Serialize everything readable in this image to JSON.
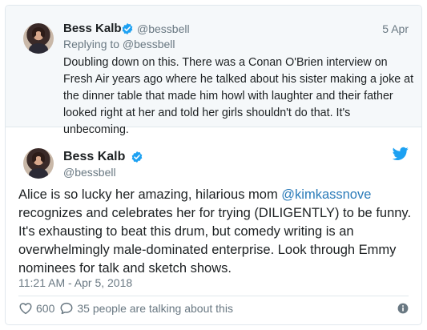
{
  "parent_tweet": {
    "name": "Bess Kalb",
    "handle": "@bessbell",
    "date": "5 Apr",
    "replying_to": "Replying to @bessbell",
    "text": "Doubling down on this. There was a Conan O'Brien interview on Fresh Air years ago where he talked about his sister making a joke at the dinner table that made him howl with laughter and their father looked right at her and told her girls shouldn't do that. It's unbecoming."
  },
  "tweet": {
    "name": "Bess Kalb",
    "handle": "@bessbell",
    "text_before": "Alice is so lucky her amazing, hilarious mom ",
    "mention": "@kimkassnove",
    "text_after": " recognizes and celebrates her for trying (DILIGENTLY) to be funny. It's exhausting to beat this drum, but comedy writing is an overwhelmingly male-dominated enterprise. Look through Emmy nominees for talk and sketch shows.",
    "timestamp": "11:21 AM - Apr 5, 2018",
    "likes": "600",
    "conversation": "35 people are talking about this"
  },
  "icons": {
    "verified": "verified-badge-icon",
    "bird": "twitter-bird-icon",
    "heart": "heart-icon",
    "reply": "speech-bubble-icon",
    "info": "info-icon"
  },
  "colors": {
    "accent": "#1da1f2",
    "link": "#2b7bb9",
    "muted": "#697882",
    "text": "#1c2022",
    "parent_bg": "#f5f8fa",
    "border": "#e1e8ed"
  }
}
